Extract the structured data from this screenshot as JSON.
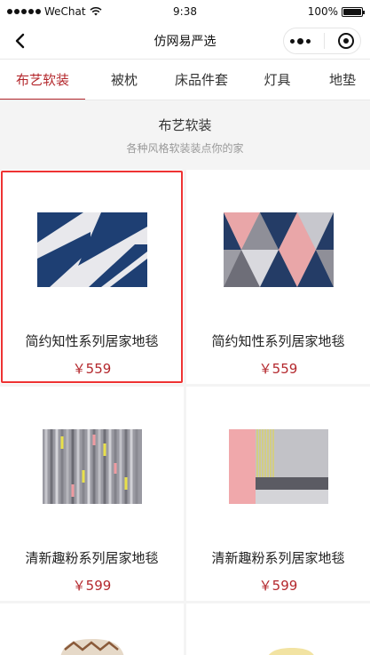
{
  "status": {
    "carrier": "WeChat",
    "time": "9:38",
    "battery": "100%",
    "battery_level": 1.0
  },
  "nav": {
    "title": "仿网易严选"
  },
  "tabs": [
    {
      "label": "布艺软装",
      "active": true
    },
    {
      "label": "被枕",
      "active": false
    },
    {
      "label": "床品件套",
      "active": false
    },
    {
      "label": "灯具",
      "active": false
    },
    {
      "label": "地垫",
      "active": false
    }
  ],
  "category": {
    "title": "布艺软装",
    "subtitle": "各种风格软装装点你的家"
  },
  "products": [
    {
      "name": "简约知性系列居家地毯",
      "price": "￥559",
      "image": "navy-white-geometric-rug",
      "selected": true
    },
    {
      "name": "简约知性系列居家地毯",
      "price": "￥559",
      "image": "triangle-pattern-rug",
      "selected": false
    },
    {
      "name": "清新趣粉系列居家地毯",
      "price": "￥599",
      "image": "striped-gray-rug",
      "selected": false
    },
    {
      "name": "清新趣粉系列居家地毯",
      "price": "￥599",
      "image": "pink-gray-block-rug",
      "selected": false
    },
    {
      "name": "",
      "price": "",
      "image": "cushion-partial",
      "selected": false
    },
    {
      "name": "",
      "price": "",
      "image": "yellow-item-partial",
      "selected": false
    }
  ],
  "colors": {
    "accent": "#b4282d",
    "highlight": "#e33333",
    "background": "#f4f4f4"
  }
}
